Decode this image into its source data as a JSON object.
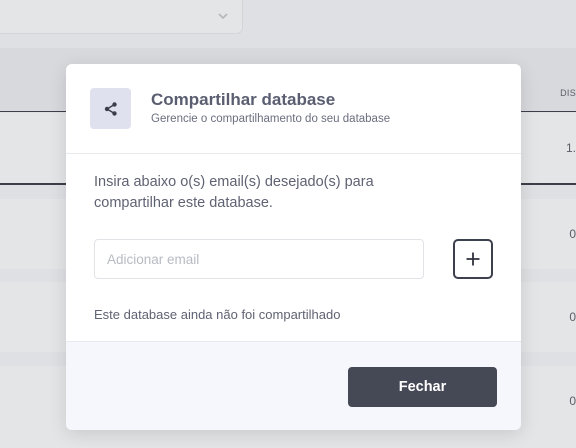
{
  "background": {
    "column_header": "DIS",
    "row_values": [
      "1.",
      "0",
      "0",
      "0"
    ]
  },
  "modal": {
    "icon": "share-icon",
    "title": "Compartilhar database",
    "subtitle": "Gerencie o compartilhamento do seu database",
    "instructions": "Insira abaixo o(s) email(s) desejado(s) para compartilhar este database.",
    "email_placeholder": "Adicionar email",
    "email_value": "",
    "add_icon": "plus-icon",
    "status_text": "Este database ainda não foi compartilhado",
    "close_label": "Fechar"
  }
}
